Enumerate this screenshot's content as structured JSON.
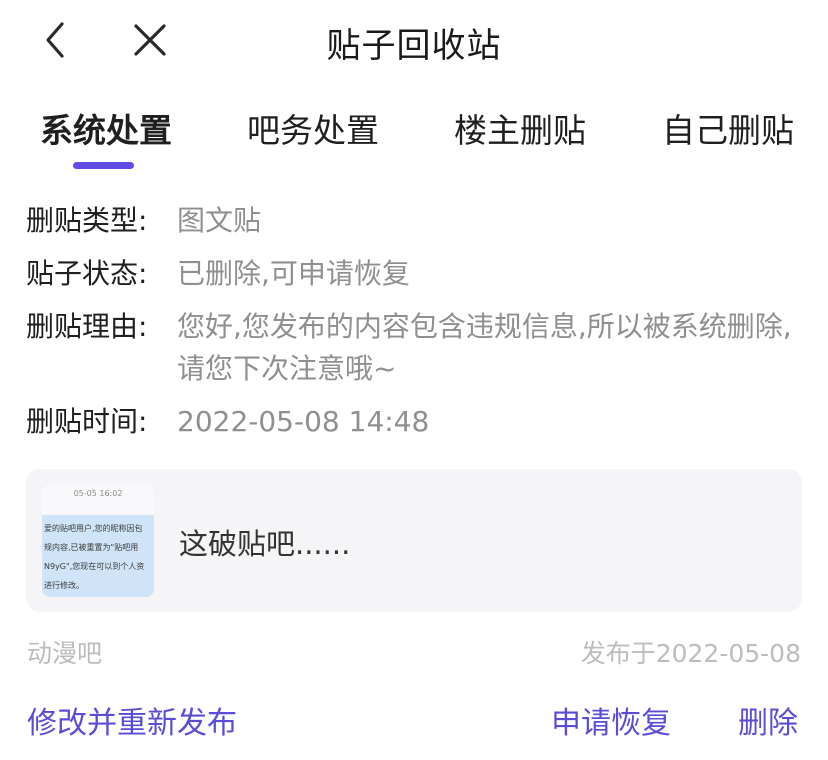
{
  "header": {
    "title": "贴子回收站",
    "back_icon": "chevron-left-icon",
    "close_icon": "close-icon"
  },
  "tabs": [
    {
      "label": "系统处置",
      "active": true
    },
    {
      "label": "吧务处置",
      "active": false
    },
    {
      "label": "楼主删贴",
      "active": false
    },
    {
      "label": "自己删贴",
      "active": false
    }
  ],
  "accent_color": "#614ce6",
  "info": {
    "type": {
      "label": "删贴类型:",
      "value": "图文贴"
    },
    "status": {
      "label": "贴子状态:",
      "value": "已删除,可申请恢复"
    },
    "reason": {
      "label": "删贴理由:",
      "value": "您好,您发布的内容包含违规信息,所以被系统删除,请您下次注意哦~"
    },
    "time": {
      "label": "删贴时间:",
      "value": "2022-05-08 14:48"
    }
  },
  "post": {
    "title": "这破贴吧......",
    "thumbnail": {
      "date": "05-05  16:02",
      "lines": [
        "爱的贴吧用户,您的昵称因包",
        "规内容,已被重置为\"贴吧用",
        "N9yG\",您现在可以到个人资",
        "进行修改。"
      ]
    },
    "forum": "动漫吧",
    "published": "发布于2022-05-08"
  },
  "actions": {
    "edit": "修改并重新发布",
    "restore": "申请恢复",
    "delete": "删除"
  }
}
